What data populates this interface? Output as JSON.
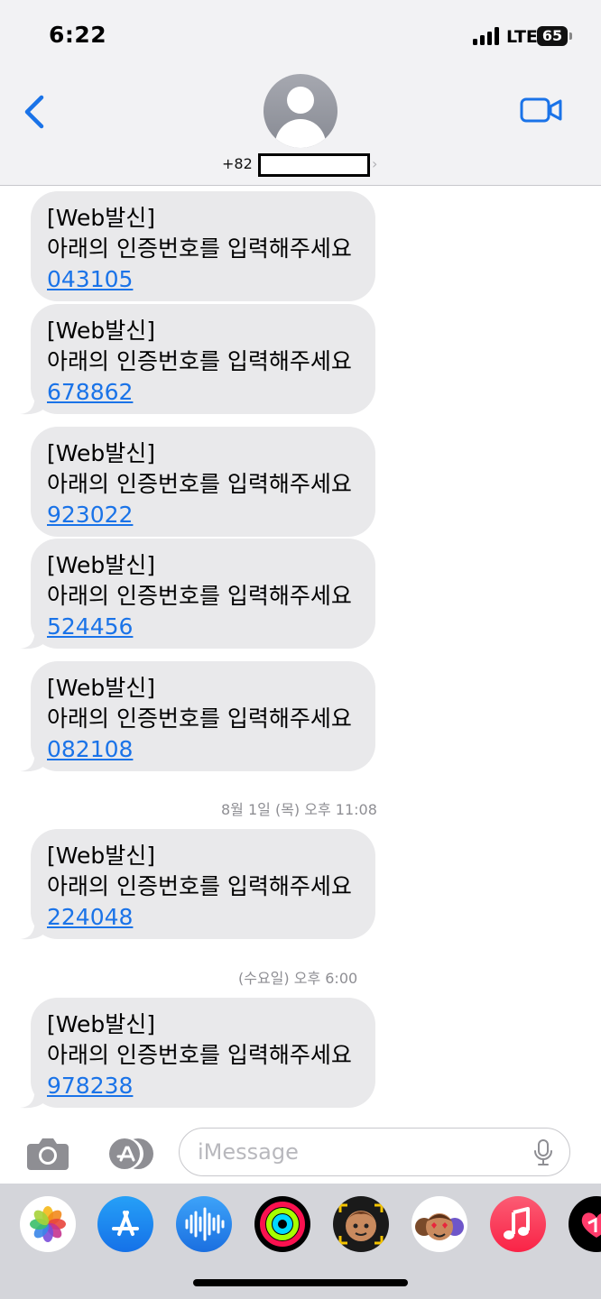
{
  "status_bar": {
    "time": "6:22",
    "network": "LTE",
    "battery": "65"
  },
  "header": {
    "contact_prefix": "+82",
    "chevron": "›"
  },
  "messages": [
    {
      "line1": "[Web발신]",
      "line2": "아래의 인증번호를 입력해주세요",
      "code": "043105"
    },
    {
      "line1": "[Web발신]",
      "line2": "아래의 인증번호를 입력해주세요",
      "code": "678862"
    },
    {
      "line1": "[Web발신]",
      "line2": "아래의 인증번호를 입력해주세요",
      "code": "923022"
    },
    {
      "line1": "[Web발신]",
      "line2": "아래의 인증번호를 입력해주세요",
      "code": "524456"
    },
    {
      "line1": "[Web발신]",
      "line2": "아래의 인증번호를 입력해주세요",
      "code": "082108"
    },
    {
      "line1": "[Web발신]",
      "line2": "아래의 인증번호를 입력해주세요",
      "code": "224048"
    },
    {
      "line1": "[Web발신]",
      "line2": "아래의 인증번호를 입력해주세요",
      "code": "978238"
    }
  ],
  "timestamps": [
    "8월 1일 (목) 오후 11:08",
    "(수요일) 오후 6:00"
  ],
  "input": {
    "placeholder": "iMessage"
  },
  "icons": {
    "back": "chevron-left-icon",
    "facetime": "video-camera-icon",
    "camera": "camera-icon",
    "apps": "app-store-icon",
    "mic": "microphone-icon"
  },
  "drawer_apps": [
    "Photos",
    "App Store",
    "Audio Messages",
    "Activity",
    "Memoji Stickers",
    "Animoji",
    "Music",
    "Digital Touch"
  ],
  "colors": {
    "accent": "#1a73e8",
    "bubble": "#e9e9eb",
    "header_bg": "#f2f2f4",
    "drawer_bg": "#d4d5da"
  }
}
